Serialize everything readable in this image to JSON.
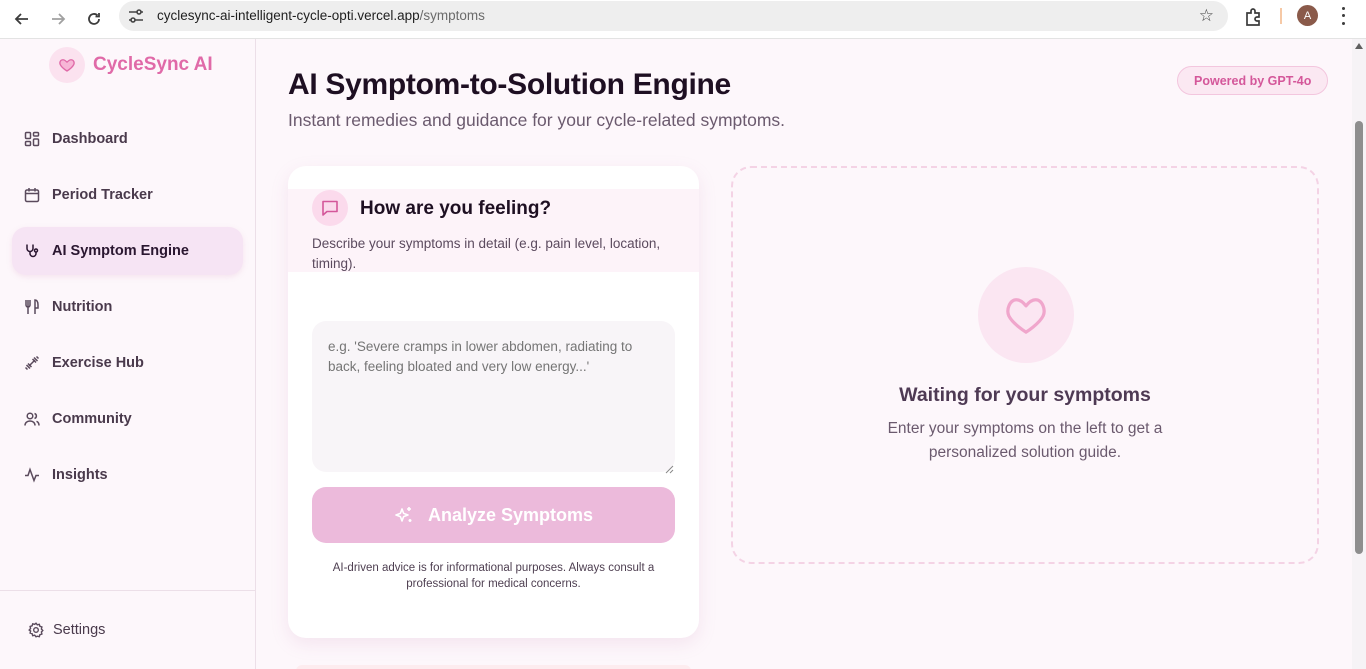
{
  "browser": {
    "url_host": "cyclesync-ai-intelligent-cycle-opti.vercel.app",
    "url_path": "/symptoms",
    "profile_initial": "A",
    "icons": [
      "back-icon",
      "forward-icon",
      "reload-icon",
      "site-settings-icon",
      "bookmark-star-icon",
      "extensions-icon",
      "more-icon"
    ]
  },
  "sidebar": {
    "brand": "CycleSync AI",
    "items": [
      {
        "label": "Dashboard",
        "icon": "dashboard-icon",
        "active": false
      },
      {
        "label": "Period Tracker",
        "icon": "calendar-icon",
        "active": false
      },
      {
        "label": "AI Symptom Engine",
        "icon": "stethoscope-icon",
        "active": true
      },
      {
        "label": "Nutrition",
        "icon": "utensils-icon",
        "active": false
      },
      {
        "label": "Exercise Hub",
        "icon": "dumbbell-icon",
        "active": false
      },
      {
        "label": "Community",
        "icon": "users-icon",
        "active": false
      },
      {
        "label": "Insights",
        "icon": "activity-icon",
        "active": false
      }
    ],
    "settings_label": "Settings"
  },
  "main": {
    "title": "AI Symptom-to-Solution Engine",
    "subtitle": "Instant remedies and guidance for your cycle-related symptoms.",
    "badge": "Powered by GPT-4o",
    "form": {
      "question": "How are you feeling?",
      "hint": "Describe your symptoms in detail (e.g. pain level, location, timing).",
      "placeholder": "e.g. 'Severe cramps in lower abdomen, radiating to back, feeling bloated and very low energy...'",
      "value": "",
      "button": "Analyze Symptoms",
      "disclaimer": "AI-driven advice is for informational purposes. Always consult a professional for medical concerns."
    },
    "waiting": {
      "title": "Waiting for your symptoms",
      "text": "Enter your symptoms on the left to get a personalized solution guide."
    }
  },
  "colors": {
    "accent": "#e06aa8",
    "button_disabled": "#ecbadb",
    "active_nav": "#f6e4f4",
    "page_bg": "#fdf7fb"
  }
}
